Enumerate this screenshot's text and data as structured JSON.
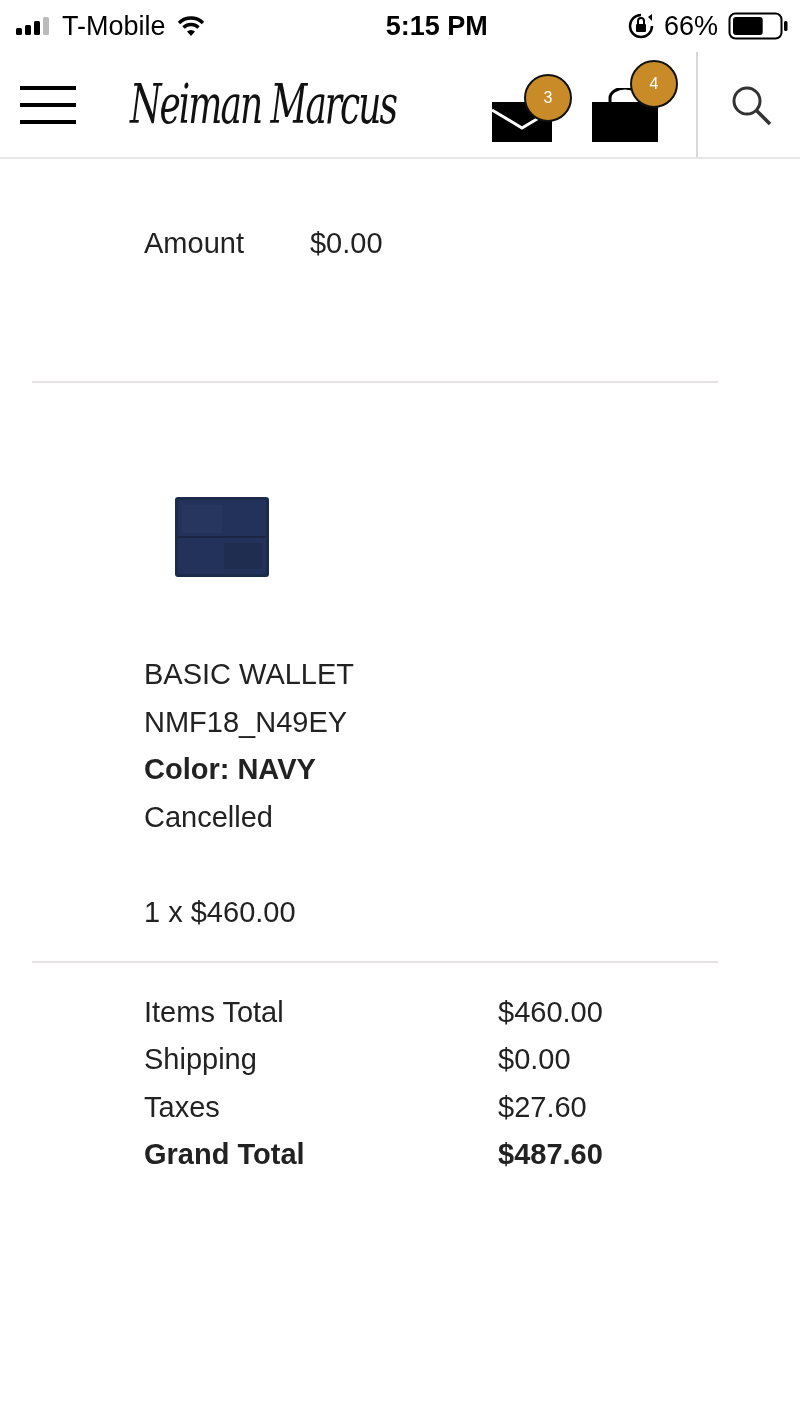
{
  "status_bar": {
    "carrier": "T-Mobile",
    "time": "5:15 PM",
    "battery": "66%"
  },
  "header": {
    "logo": "Neiman Marcus",
    "messages_badge": "3",
    "bag_badge": "4"
  },
  "payment": {
    "label": "Amount",
    "value": "$0.00"
  },
  "item": {
    "name": "BASIC WALLET",
    "sku": "NMF18_N49EY",
    "color_label": "Color: NAVY",
    "status": "Cancelled",
    "quantity_price": "1 x $460.00"
  },
  "totals": [
    {
      "label": "Items Total",
      "value": "$460.00",
      "kind": "line"
    },
    {
      "label": "Shipping",
      "value": "$0.00",
      "kind": "line"
    },
    {
      "label": "Taxes",
      "value": "$27.60",
      "kind": "line"
    },
    {
      "label": "Grand Total",
      "value": "$487.60",
      "kind": "total"
    }
  ]
}
